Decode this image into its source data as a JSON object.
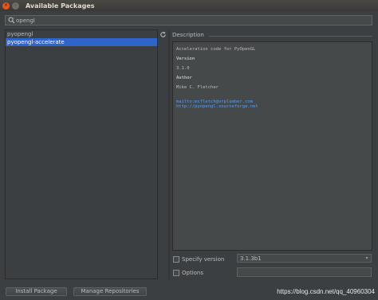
{
  "window": {
    "title": "Available Packages",
    "close_glyph": "×",
    "min_glyph": "–"
  },
  "search": {
    "value": "opengl",
    "icon": "search-icon"
  },
  "packages": [
    {
      "name": "pyopengl",
      "selected": false
    },
    {
      "name": "pyopengl-accelerate",
      "selected": true
    }
  ],
  "description": {
    "label": "Description",
    "summary": "Acceleration code for PyOpenGL",
    "version_heading": "Version",
    "version": "3.1.0",
    "author_heading": "Author",
    "author": "Mike C. Fletcher",
    "email_link": "mailto:mcfletch@vrplumber.com",
    "homepage_link": "http://pyopengl.sourceforge.net"
  },
  "specify_version": {
    "label": "Specify version",
    "checked": false,
    "selected_value": "3.1.3b1"
  },
  "options": {
    "label": "Options",
    "checked": false,
    "value": ""
  },
  "buttons": {
    "install": "Install Package",
    "manage": "Manage Repositories"
  },
  "watermark": "https://blog.csdn.net/qq_40960304",
  "colors": {
    "selection": "#2f65ca",
    "link": "#589df6",
    "close_button": "#e9541e"
  }
}
